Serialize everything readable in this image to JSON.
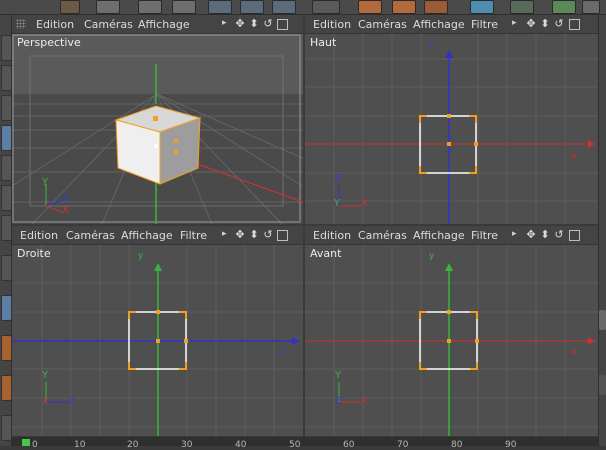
{
  "menus": {
    "persp": [
      "Edition",
      "Caméras",
      "Affichage"
    ],
    "full": [
      "Edition",
      "Caméras",
      "Affichage",
      "Filtre"
    ]
  },
  "nav_icons": {
    "arrow": "▸",
    "move": "✥",
    "zoom": "⬍",
    "rotate": "↺"
  },
  "viewports": {
    "perspective": {
      "label": "Perspective",
      "axes": {
        "y": "Y",
        "z": "Z",
        "x": "X"
      }
    },
    "top": {
      "label": "Haut",
      "axes": {
        "z_top": "z",
        "x_right": "x",
        "z": "Z",
        "y": "Y",
        "x": "X"
      }
    },
    "right": {
      "label": "Droite",
      "axes": {
        "y_top": "y",
        "z_right": "z",
        "y": "Y",
        "z": "Z",
        "x": "X"
      }
    },
    "front": {
      "label": "Avant",
      "axes": {
        "y_top": "y",
        "x_right": "x",
        "y": "Y",
        "x": "X",
        "z": "Z"
      }
    }
  },
  "timeline": {
    "ticks": [
      "0",
      "10",
      "20",
      "30",
      "40",
      "50",
      "60",
      "70",
      "80",
      "90"
    ]
  },
  "colors": {
    "x_axis": "#c83232",
    "y_axis": "#3cb43c",
    "z_axis": "#3232c8",
    "selection": "#f0a020",
    "grid": "#5a5a5a"
  }
}
